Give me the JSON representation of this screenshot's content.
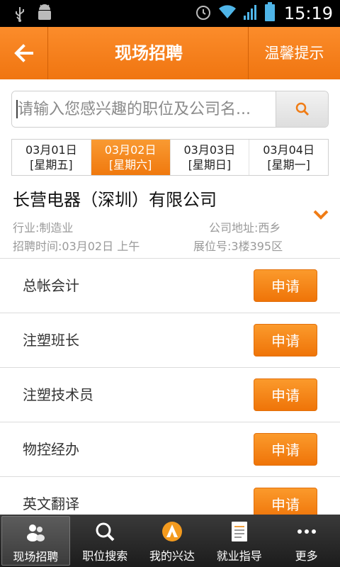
{
  "status_bar": {
    "time": "15:19"
  },
  "header": {
    "title": "现场招聘",
    "tips_label": "温馨提示"
  },
  "search": {
    "placeholder": "请输入您感兴趣的职位及公司名..."
  },
  "date_tabs": [
    {
      "date": "03月01日",
      "weekday": "[星期五]"
    },
    {
      "date": "03月02日",
      "weekday": "[星期六]"
    },
    {
      "date": "03月03日",
      "weekday": "[星期日]"
    },
    {
      "date": "03月04日",
      "weekday": "[星期一]"
    }
  ],
  "company": {
    "name": "长营电器（深圳）有限公司",
    "industry": "行业:制造业",
    "address": "公司地址:西乡",
    "time": "招聘时间:03月02日 上午",
    "booth": "展位号:3楼395区"
  },
  "jobs": [
    {
      "title": "总帐会计",
      "button": "申请"
    },
    {
      "title": "注塑班长",
      "button": "申请"
    },
    {
      "title": "注塑技术员",
      "button": "申请"
    },
    {
      "title": "物控经办",
      "button": "申请"
    },
    {
      "title": "英文翻译",
      "button": "申请"
    }
  ],
  "bottom_nav": [
    {
      "label": "现场招聘",
      "icon": "people-icon"
    },
    {
      "label": "职位搜索",
      "icon": "search-icon"
    },
    {
      "label": "我的兴达",
      "icon": "logo-icon"
    },
    {
      "label": "就业指导",
      "icon": "document-icon"
    },
    {
      "label": "更多",
      "icon": "more-icon"
    }
  ],
  "colors": {
    "accent": "#f07c15",
    "nav_bg": "#2a2a2a"
  }
}
